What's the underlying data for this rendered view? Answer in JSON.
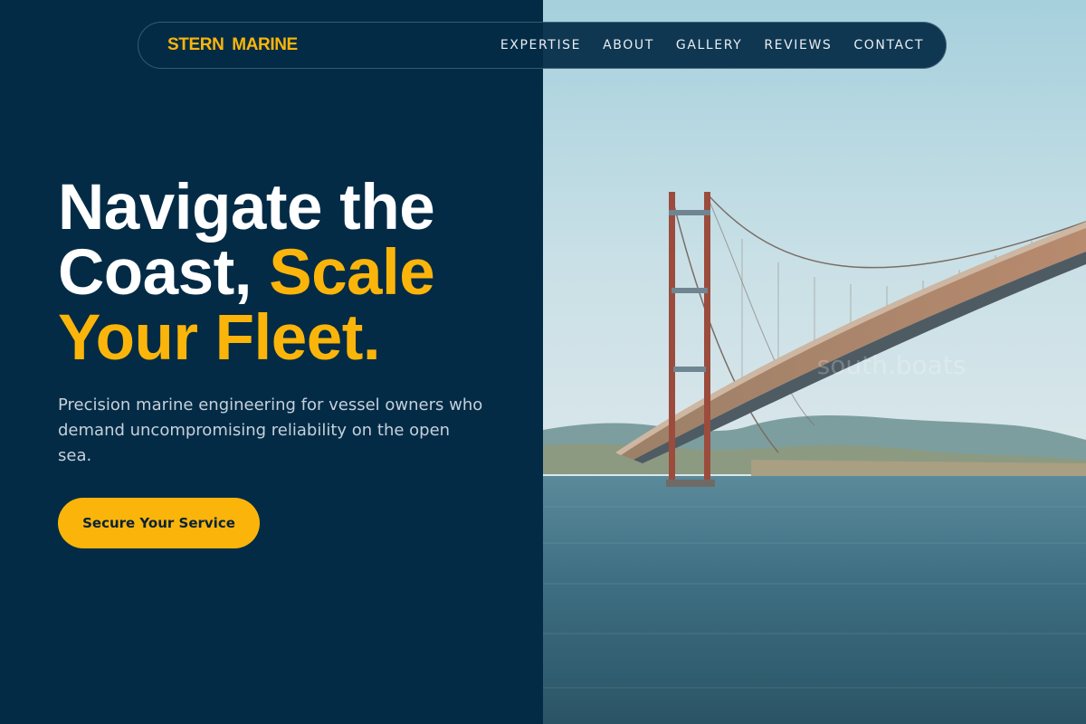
{
  "brand": {
    "name": "STERN MARINE",
    "accent_color": "#fbb50a",
    "background_color": "#032b46"
  },
  "nav": {
    "links": [
      {
        "label": "EXPERTISE"
      },
      {
        "label": "ABOUT"
      },
      {
        "label": "GALLERY"
      },
      {
        "label": "REVIEWS"
      },
      {
        "label": "CONTACT"
      }
    ]
  },
  "hero": {
    "headline_white_1": "Navigate the",
    "headline_white_2": "Coast, ",
    "headline_accent_1": "Scale",
    "headline_accent_2": "Your Fleet.",
    "description": "Precision marine engineering for vessel owners who demand uncompromising reliability on the open sea.",
    "cta_label": "Secure Your Service",
    "image_watermark": "south.boats"
  }
}
